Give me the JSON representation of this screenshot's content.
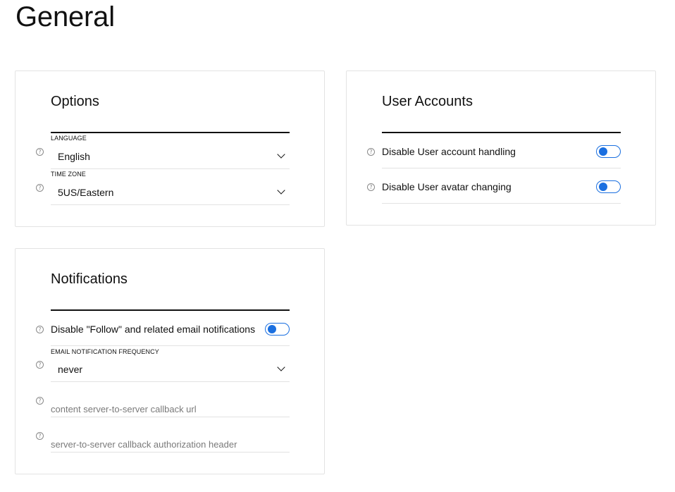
{
  "page": {
    "title": "General"
  },
  "options": {
    "title": "Options",
    "language": {
      "label": "LANGUAGE",
      "value": "English",
      "help_icon": "question-circle-icon",
      "dropdown_icon": "chevron-down-icon"
    },
    "time_zone": {
      "label": "TIME ZONE",
      "value": "5US/Eastern",
      "help_icon": "question-circle-icon",
      "dropdown_icon": "chevron-down-icon"
    }
  },
  "user_accounts": {
    "title": "User Accounts",
    "items": [
      {
        "label": "Disable User account handling",
        "enabled": false,
        "help_icon": "question-circle-icon"
      },
      {
        "label": "Disable User avatar changing",
        "enabled": false,
        "help_icon": "question-circle-icon"
      }
    ]
  },
  "notifications": {
    "title": "Notifications",
    "follow_toggle": {
      "label": "Disable \"Follow\" and related email notifications",
      "enabled": false,
      "help_icon": "question-circle-icon"
    },
    "email_frequency": {
      "label": "EMAIL NOTIFICATION FREQUENCY",
      "value": "never",
      "help_icon": "question-circle-icon",
      "dropdown_icon": "chevron-down-icon"
    },
    "callback_url": {
      "value": "",
      "placeholder": "content server-to-server callback url",
      "help_icon": "question-circle-icon"
    },
    "callback_auth_header": {
      "value": "",
      "placeholder": "server-to-server callback authorization header",
      "help_icon": "question-circle-icon"
    }
  },
  "colors": {
    "accent": "#1a6fe0",
    "text": "#111111",
    "placeholder": "#7a7a7a",
    "divider": "#e2e2e2",
    "card_border": "#e3e3e3"
  }
}
